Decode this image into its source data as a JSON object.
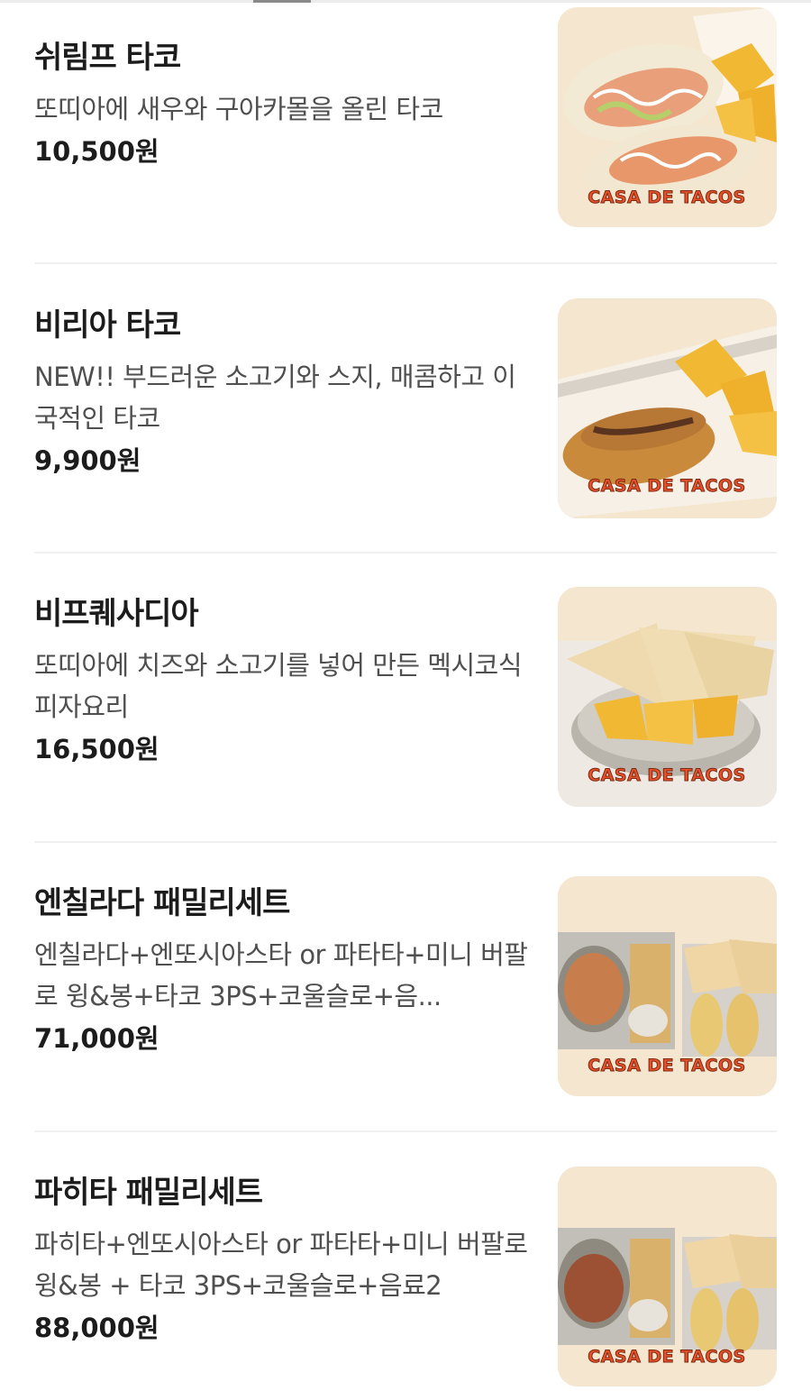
{
  "menu": {
    "items": [
      {
        "name": "쉬림프 타코",
        "description": "또띠아에 새우와 구아카몰을 올린 타코",
        "price": "10,500원",
        "image_brand": "CASA DE TACOS"
      },
      {
        "name": "비리아 타코",
        "description": "NEW!! 부드러운 소고기와 스지, 매콤하고 이국적인 타코",
        "price": "9,900원",
        "image_brand": "CASA DE TACOS"
      },
      {
        "name": "비프퀘사디아",
        "description": "또띠아에 치즈와 소고기를 넣어 만든 멕시코식 피자요리",
        "price": "16,500원",
        "image_brand": "CASA DE TACOS"
      },
      {
        "name": "엔칠라다 패밀리세트",
        "description": "엔칠라다+엔또시아스타 or 파타타+미니 버팔로 윙&봉+타코 3PS+코울슬로+음...",
        "price": "71,000원",
        "image_brand": "CASA DE TACOS"
      },
      {
        "name": "파히타 패밀리세트",
        "description": "파히타+엔또시아스타 or 파타타+미니 버팔로윙&봉 + 타코 3PS+코울슬로+음료2",
        "price": "88,000원",
        "image_brand": "CASA DE TACOS"
      }
    ]
  },
  "colors": {
    "image_background": "#f5e7cf",
    "brand_text": "#e8502a",
    "divider": "#f0f0f0"
  }
}
